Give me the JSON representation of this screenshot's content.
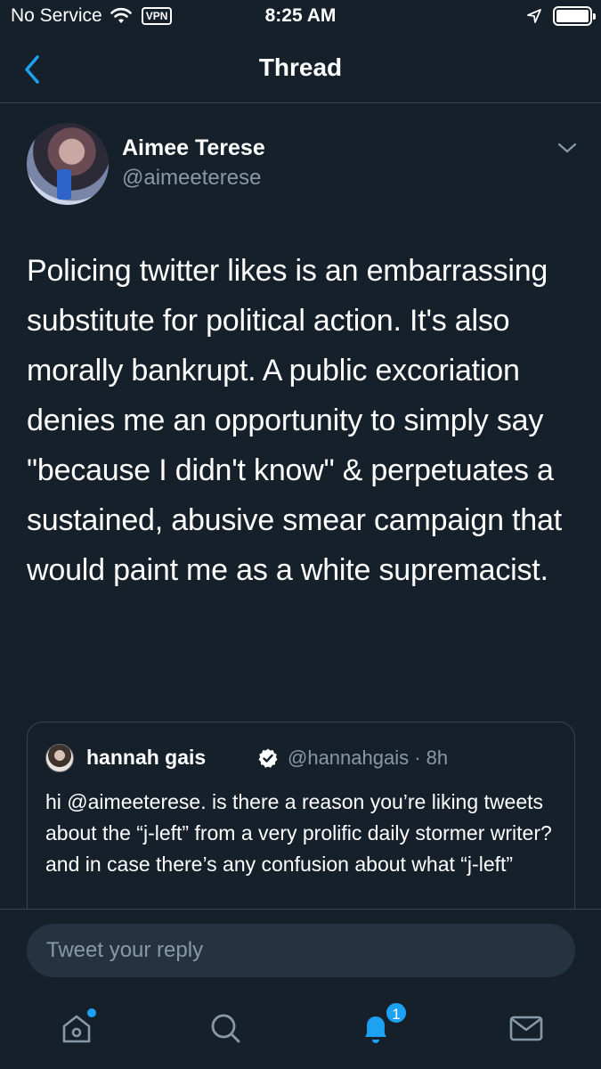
{
  "status_bar": {
    "carrier": "No Service",
    "vpn": "VPN",
    "time": "8:25 AM"
  },
  "nav": {
    "title": "Thread"
  },
  "tweet": {
    "author_name": "Aimee Terese",
    "author_handle": "@aimeeterese",
    "text": "Policing twitter likes is an embarrassing substitute for political action. It's also morally bankrupt. A public excoriation denies me an opportunity to simply say \"because I didn't know\" & perpetuates a sustained, abusive smear campaign that would paint me as a white supremacist."
  },
  "quoted_tweet": {
    "author_name": "hannah gais",
    "author_handle": "@hannahgais · 8h",
    "text": "hi @aimeeterese. is there a reason you’re liking tweets about the “j-left” from a very prolific daily stormer writer? and in case there’s any confusion about what “j-left”"
  },
  "reply": {
    "placeholder": "Tweet your reply"
  },
  "tab_bar": {
    "notifications_count": "1"
  },
  "colors": {
    "background": "#15202b",
    "accent": "#1da1f2",
    "secondary_text": "#8899a6",
    "divider": "#38444d"
  },
  "icons": [
    "back-chevron-icon",
    "wifi-icon",
    "location-arrow-icon",
    "battery-icon",
    "chevron-down-icon",
    "verified-icon",
    "home-icon",
    "search-icon",
    "bell-icon",
    "mail-icon"
  ]
}
